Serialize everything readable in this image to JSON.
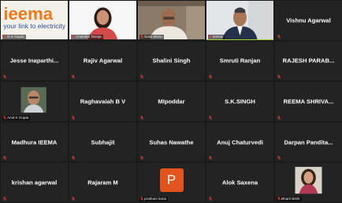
{
  "participants": [
    {
      "name": "IEEMA",
      "label": "G K Gupta",
      "type": "video",
      "scene": "logo",
      "logo_text": "ieema",
      "tagline": "your link to electricity"
    },
    {
      "name": "Anamika Taneja",
      "label": "Anamika Taneja",
      "type": "video",
      "scene": "woman-white"
    },
    {
      "name": "Sunil Misra",
      "label": "Sunil Misra",
      "type": "video",
      "scene": "man-bookshelf"
    },
    {
      "name": "ieema",
      "label": "ieema",
      "type": "video",
      "scene": "man-suit",
      "active": true
    },
    {
      "name": "Vishnu Agarwal",
      "type": "text"
    },
    {
      "name": "Jesse Inaparthi...",
      "type": "text"
    },
    {
      "name": "Rajiv Agarwal",
      "type": "text"
    },
    {
      "name": "Shalini Singh",
      "type": "text"
    },
    {
      "name": "Smruti Ranjan",
      "type": "text"
    },
    {
      "name": "RAJESH PARAB...",
      "type": "text"
    },
    {
      "name": "Amit K Gupta",
      "label": "Amit K Gupta",
      "type": "video",
      "scene": "man-glasses"
    },
    {
      "name": "Raghavaiah B V",
      "type": "text"
    },
    {
      "name": "MIpoddar",
      "type": "text"
    },
    {
      "name": "S.K.SINGH",
      "type": "text"
    },
    {
      "name": "REEMA SHRIVA...",
      "type": "text"
    },
    {
      "name": "Madhura IEEMA",
      "type": "text"
    },
    {
      "name": "Subhajit",
      "type": "text"
    },
    {
      "name": "Suhas Nawathe",
      "type": "text"
    },
    {
      "name": "Anuj Chaturvedi",
      "type": "text"
    },
    {
      "name": "Darpan Pandita...",
      "type": "text"
    },
    {
      "name": "krishan agarwal",
      "type": "text"
    },
    {
      "name": "Rajaram M",
      "type": "text"
    },
    {
      "name": "pratham karia",
      "label": "pratham karia",
      "type": "avatar",
      "initial": "P",
      "color": "#e2541d"
    },
    {
      "name": "Alok Saxena",
      "type": "text"
    },
    {
      "name": "Bharti Bisht",
      "label": "Bharti Bisht",
      "type": "video",
      "scene": "woman-photo"
    }
  ],
  "colors": {
    "background": "#1a1a1a",
    "tile": "#232323",
    "active_speaker": "#9ed52a",
    "muted_mic": "#e0413a"
  }
}
